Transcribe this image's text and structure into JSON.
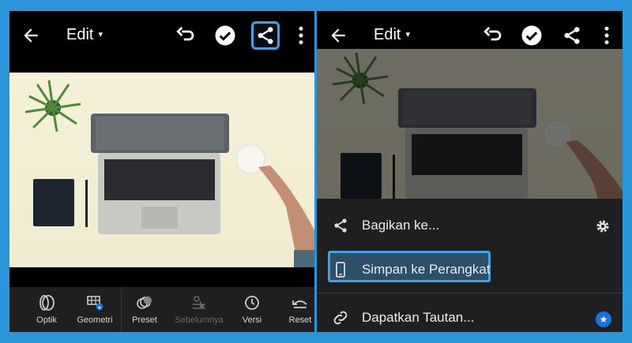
{
  "left": {
    "header": {
      "title": "Edit",
      "caret": "▾"
    },
    "toolbar": [
      {
        "label": "Optik",
        "icon": "optics-icon",
        "enabled": true
      },
      {
        "label": "Geometri",
        "icon": "geometry-icon",
        "enabled": true
      },
      {
        "label": "Preset",
        "icon": "preset-icon",
        "enabled": true
      },
      {
        "label": "Sebelumnya",
        "icon": "previous-icon",
        "enabled": false
      },
      {
        "label": "Versi",
        "icon": "versions-icon",
        "enabled": true
      },
      {
        "label": "Reset",
        "icon": "reset-icon",
        "enabled": true
      }
    ]
  },
  "right": {
    "header": {
      "title": "Edit",
      "caret": "▾"
    },
    "share_sheet": {
      "share_label": "Bagikan ke...",
      "save_label": "Simpan ke Perangkat",
      "link_label": "Dapatkan Tautan...",
      "premium_badge": "★"
    }
  },
  "colors": {
    "frame": "#2b95dc",
    "highlight": "#3ba3e6",
    "panel_bg": "#1f1f1f",
    "badge": "#1473e6"
  }
}
